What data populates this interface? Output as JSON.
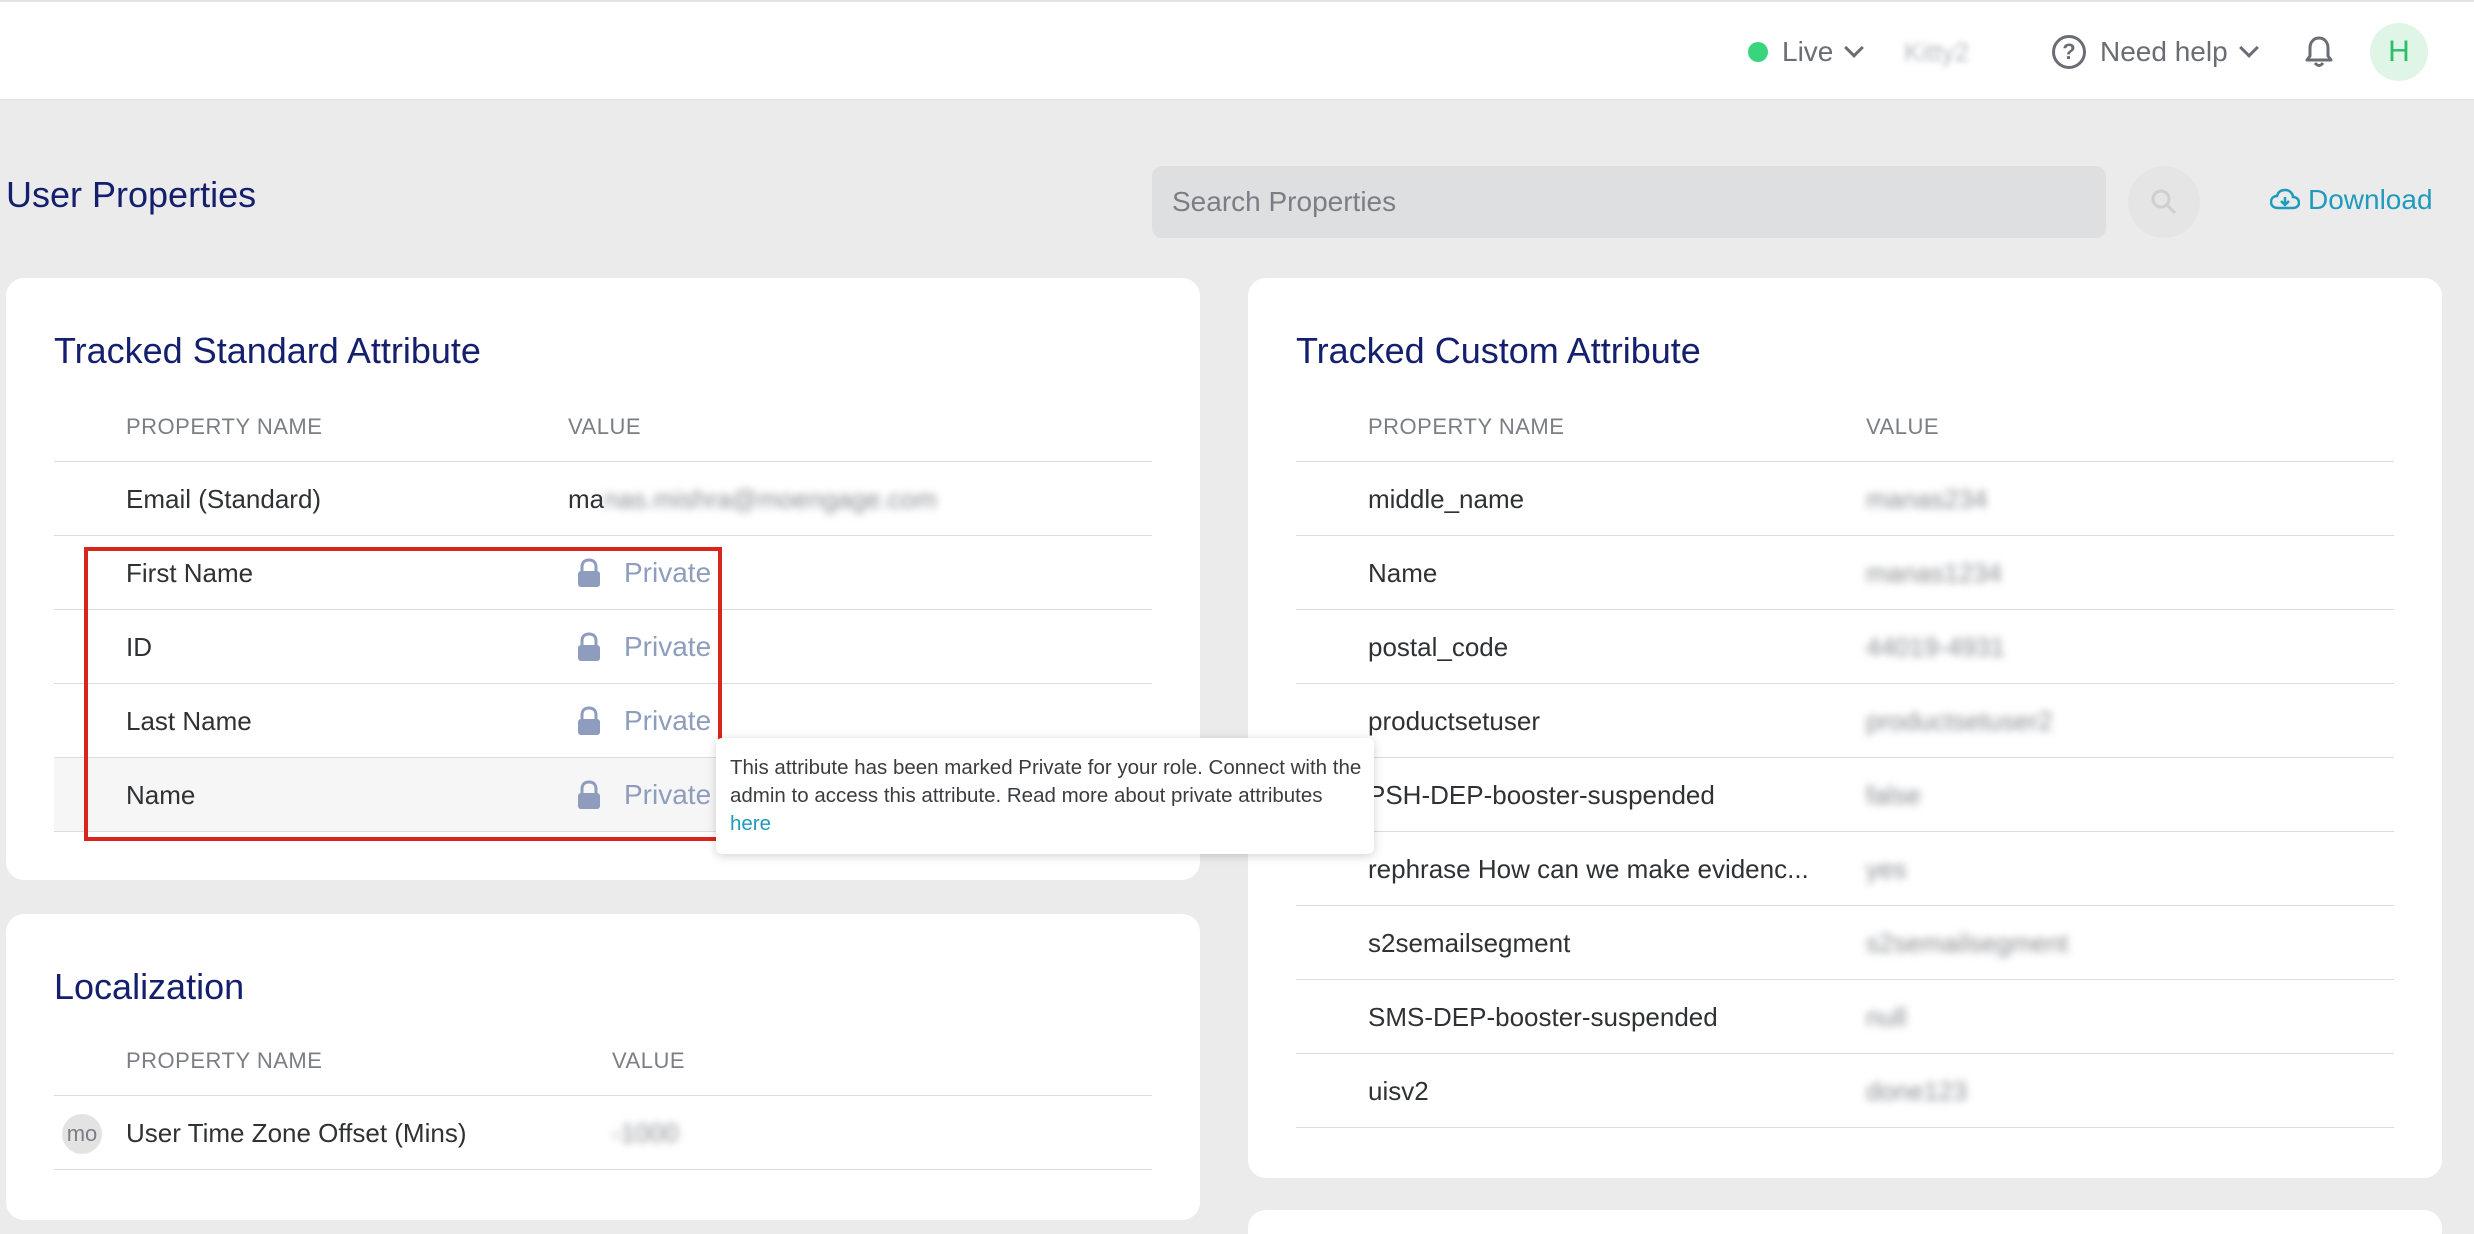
{
  "header": {
    "environment": {
      "label": "Live",
      "status_color": "#3ad47c"
    },
    "workspace": "Kitty2",
    "help": {
      "label": "Need help"
    },
    "avatar_initial": "H"
  },
  "page": {
    "title": "User Properties",
    "search_placeholder": "Search Properties",
    "download_label": "Download"
  },
  "standard": {
    "title": "Tracked Standard Attribute",
    "columns": [
      "PROPERTY NAME",
      "VALUE"
    ],
    "rows": [
      {
        "name": "Email (Standard)",
        "value_prefix": "ma",
        "value_hidden": "nas.mishra@moengage.com"
      },
      {
        "name": "First Name",
        "value": "Private"
      },
      {
        "name": "ID",
        "value": "Private"
      },
      {
        "name": "Last Name",
        "value": "Private"
      },
      {
        "name": "Name",
        "value": "Private"
      }
    ]
  },
  "tooltip": {
    "text": "This attribute has been marked Private for your role. Connect with the admin to access this attribute. Read more about private attributes",
    "link": "here"
  },
  "localization": {
    "title": "Localization",
    "columns": [
      "PROPERTY NAME",
      "VALUE"
    ],
    "rows": [
      {
        "badge": "mo",
        "name": "User Time Zone Offset (Mins)",
        "value": "-1000"
      }
    ]
  },
  "custom": {
    "title": "Tracked Custom Attribute",
    "columns": [
      "PROPERTY NAME",
      "VALUE"
    ],
    "rows": [
      {
        "name": "middle_name",
        "value": "manas234"
      },
      {
        "name": "Name",
        "value": "manas1234"
      },
      {
        "name": "postal_code",
        "value": "44019-4931"
      },
      {
        "name": "productsetuser",
        "value": "productsetuser2"
      },
      {
        "name": "PSH-DEP-booster-suspended",
        "value": "false"
      },
      {
        "name": "rephrase How can we make evidenc...",
        "value": "yes"
      },
      {
        "name": "s2semailsegment",
        "value": "s2semailsegment"
      },
      {
        "name": "SMS-DEP-booster-suspended",
        "value": "null"
      },
      {
        "name": "uisv2",
        "value": "done123"
      }
    ]
  }
}
